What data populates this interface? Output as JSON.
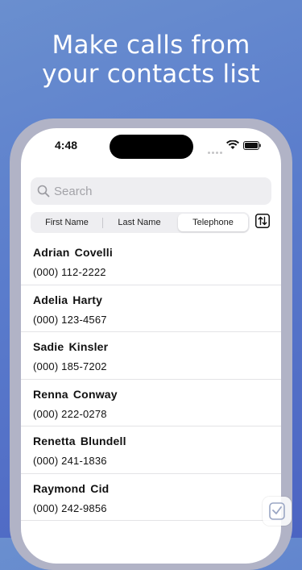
{
  "headline": {
    "line1": "Make calls from",
    "line2": "your contacts list"
  },
  "status_bar": {
    "time": "4:48"
  },
  "search": {
    "placeholder": "Search"
  },
  "segments": [
    {
      "label": "First Name",
      "selected": false
    },
    {
      "label": "Last Name",
      "selected": false
    },
    {
      "label": "Telephone",
      "selected": true
    }
  ],
  "contacts": [
    {
      "name": "Adrian Covelli",
      "phone": "(000) 112-2222"
    },
    {
      "name": "Adelia Harty",
      "phone": "(000) 123-4567"
    },
    {
      "name": "Sadie Kinsler",
      "phone": "(000) 185-7202"
    },
    {
      "name": "Renna Conway",
      "phone": "(000) 222-0278"
    },
    {
      "name": "Renetta Blundell",
      "phone": "(000) 241-1836"
    },
    {
      "name": "Raymond Cid",
      "phone": "(000) 242-9856"
    }
  ],
  "colors": {
    "accent": "#5b7ccb",
    "selected_segment": "#ffffff"
  },
  "icons": {
    "search": "magnifier-icon",
    "sort": "sort-arrows-icon",
    "badge": "app-store-badge-icon"
  }
}
